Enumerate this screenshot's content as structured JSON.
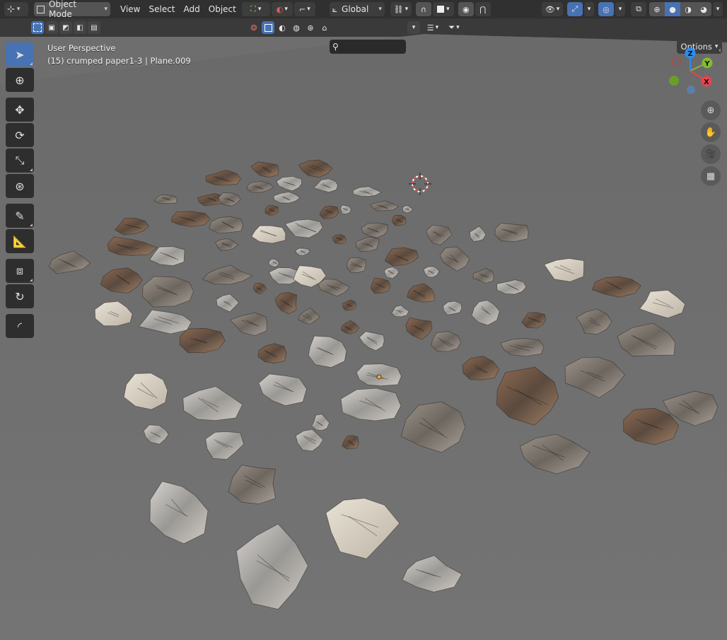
{
  "header": {
    "editor_type_icon": "editor-type-icon",
    "mode": "Object Mode",
    "menus": [
      "View",
      "Select",
      "Add",
      "Object"
    ],
    "transform_orientation": "Global"
  },
  "subheader": {
    "options_label": "Options",
    "search_value": "",
    "search_placeholder": ""
  },
  "viewport": {
    "view_name": "User Perspective",
    "object_info": "(15) crumped paper1-3 | Plane.009"
  },
  "gizmo": {
    "z_label": "Z",
    "y_label": "Y",
    "x_label": "X"
  },
  "colors": {
    "accent": "#4772b3",
    "axis_x": "#e8434f",
    "axis_y": "#83ba2f",
    "axis_z": "#2b8ef0"
  }
}
